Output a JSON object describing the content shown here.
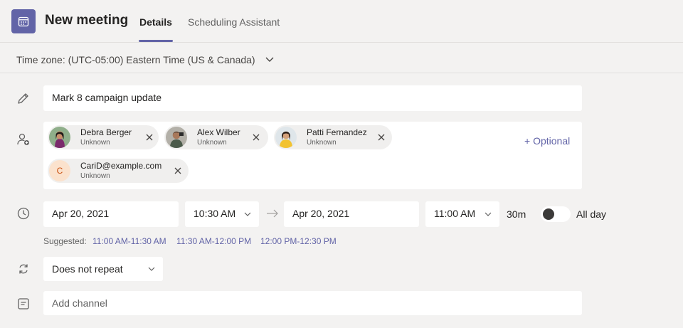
{
  "header": {
    "app_icon": "calendar-icon",
    "title": "New meeting",
    "tabs": [
      {
        "label": "Details",
        "active": true
      },
      {
        "label": "Scheduling Assistant",
        "active": false
      }
    ],
    "accent_color": "#6264a7"
  },
  "timezone": {
    "label": "Time zone: (UTC-05:00) Eastern Time (US & Canada)",
    "icon": "chevron-down-icon"
  },
  "meeting_title": {
    "icon": "pencil-icon",
    "value": "Mark 8 campaign update"
  },
  "attendees": {
    "icon": "add-person-icon",
    "optional_label": "+ Optional",
    "people": [
      {
        "name": "Debra Berger",
        "status": "Unknown"
      },
      {
        "name": "Alex Wilber",
        "status": "Unknown"
      },
      {
        "name": "Patti Fernandez",
        "status": "Unknown"
      },
      {
        "name": "CariD@example.com",
        "status": "Unknown",
        "initial": "C"
      }
    ]
  },
  "schedule": {
    "icon": "clock-icon",
    "start_date": "Apr 20, 2021",
    "start_time": "10:30 AM",
    "end_date": "Apr 20, 2021",
    "end_time": "11:00 AM",
    "duration": "30m",
    "all_day_label": "All day",
    "all_day_on": false
  },
  "suggested": {
    "label": "Suggested:",
    "slots": [
      "11:00 AM-11:30 AM",
      "11:30 AM-12:00 PM",
      "12:00 PM-12:30 PM"
    ]
  },
  "repeat": {
    "icon": "repeat-icon",
    "value": "Does not repeat"
  },
  "channel": {
    "icon": "channel-icon",
    "placeholder": "Add channel"
  }
}
